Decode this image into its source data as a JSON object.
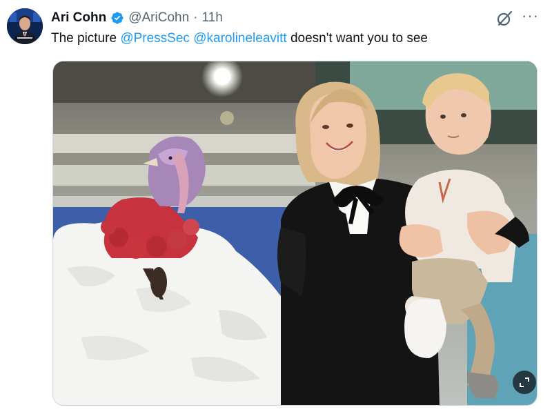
{
  "author": {
    "display_name": "Ari Cohn",
    "handle": "@AriCohn",
    "separator": "·",
    "time": "11h",
    "avatar_icon": "profile-photo-icon",
    "verified_icon": "verified-badge-icon",
    "verified_color": "#1d9bf0"
  },
  "tweet": {
    "text_before": "The picture ",
    "mention_1": "@PressSec",
    "space": " ",
    "mention_2": "@karolineleavitt",
    "text_after": " doesn't want you to see",
    "mention_color": "#1d9bf0"
  },
  "actions": {
    "grok_icon": "grok-icon",
    "more_icon": "more-options-icon",
    "more_label": "···",
    "expand_icon": "expand-icon"
  },
  "media": {
    "kind": "photo"
  }
}
